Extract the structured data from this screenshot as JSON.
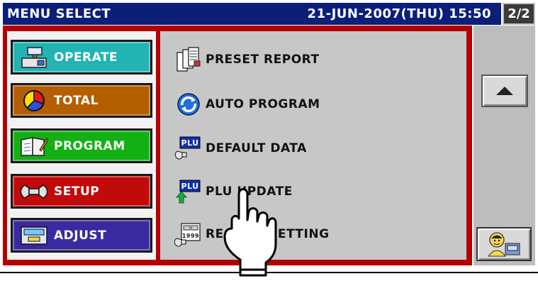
{
  "header": {
    "title": "MENU SELECT",
    "datetime": "21-JUN-2007(THU) 15:50",
    "page": "2/2"
  },
  "left_menu": [
    {
      "label": "OPERATE",
      "color": "#22b3b3",
      "icon": "register-icon"
    },
    {
      "label": "TOTAL",
      "color": "#b35f00",
      "icon": "pie-chart-icon"
    },
    {
      "label": "PROGRAM",
      "color": "#13b013",
      "icon": "notebook-icon"
    },
    {
      "label": "SETUP",
      "color": "#c20a0a",
      "icon": "wrench-icon"
    },
    {
      "label": "ADJUST",
      "color": "#3a2aa0",
      "icon": "scale-icon"
    }
  ],
  "right_menu": [
    {
      "label": "PRESET REPORT",
      "icon": "report-icon"
    },
    {
      "label": "AUTO PROGRAM",
      "icon": "refresh-icon"
    },
    {
      "label": "DEFAULT DATA",
      "icon": "plu-wrench-icon"
    },
    {
      "label": "PLU UPDATE",
      "icon": "plu-arrow-icon"
    },
    {
      "label": "RECEIPT SETTING",
      "icon": "receipt-icon"
    }
  ],
  "sidebar": {
    "up_icon": "triangle-up-icon",
    "operator_icon": "operator-icon"
  },
  "plu_tag": "PLU",
  "receipt_icon_text": "1999"
}
